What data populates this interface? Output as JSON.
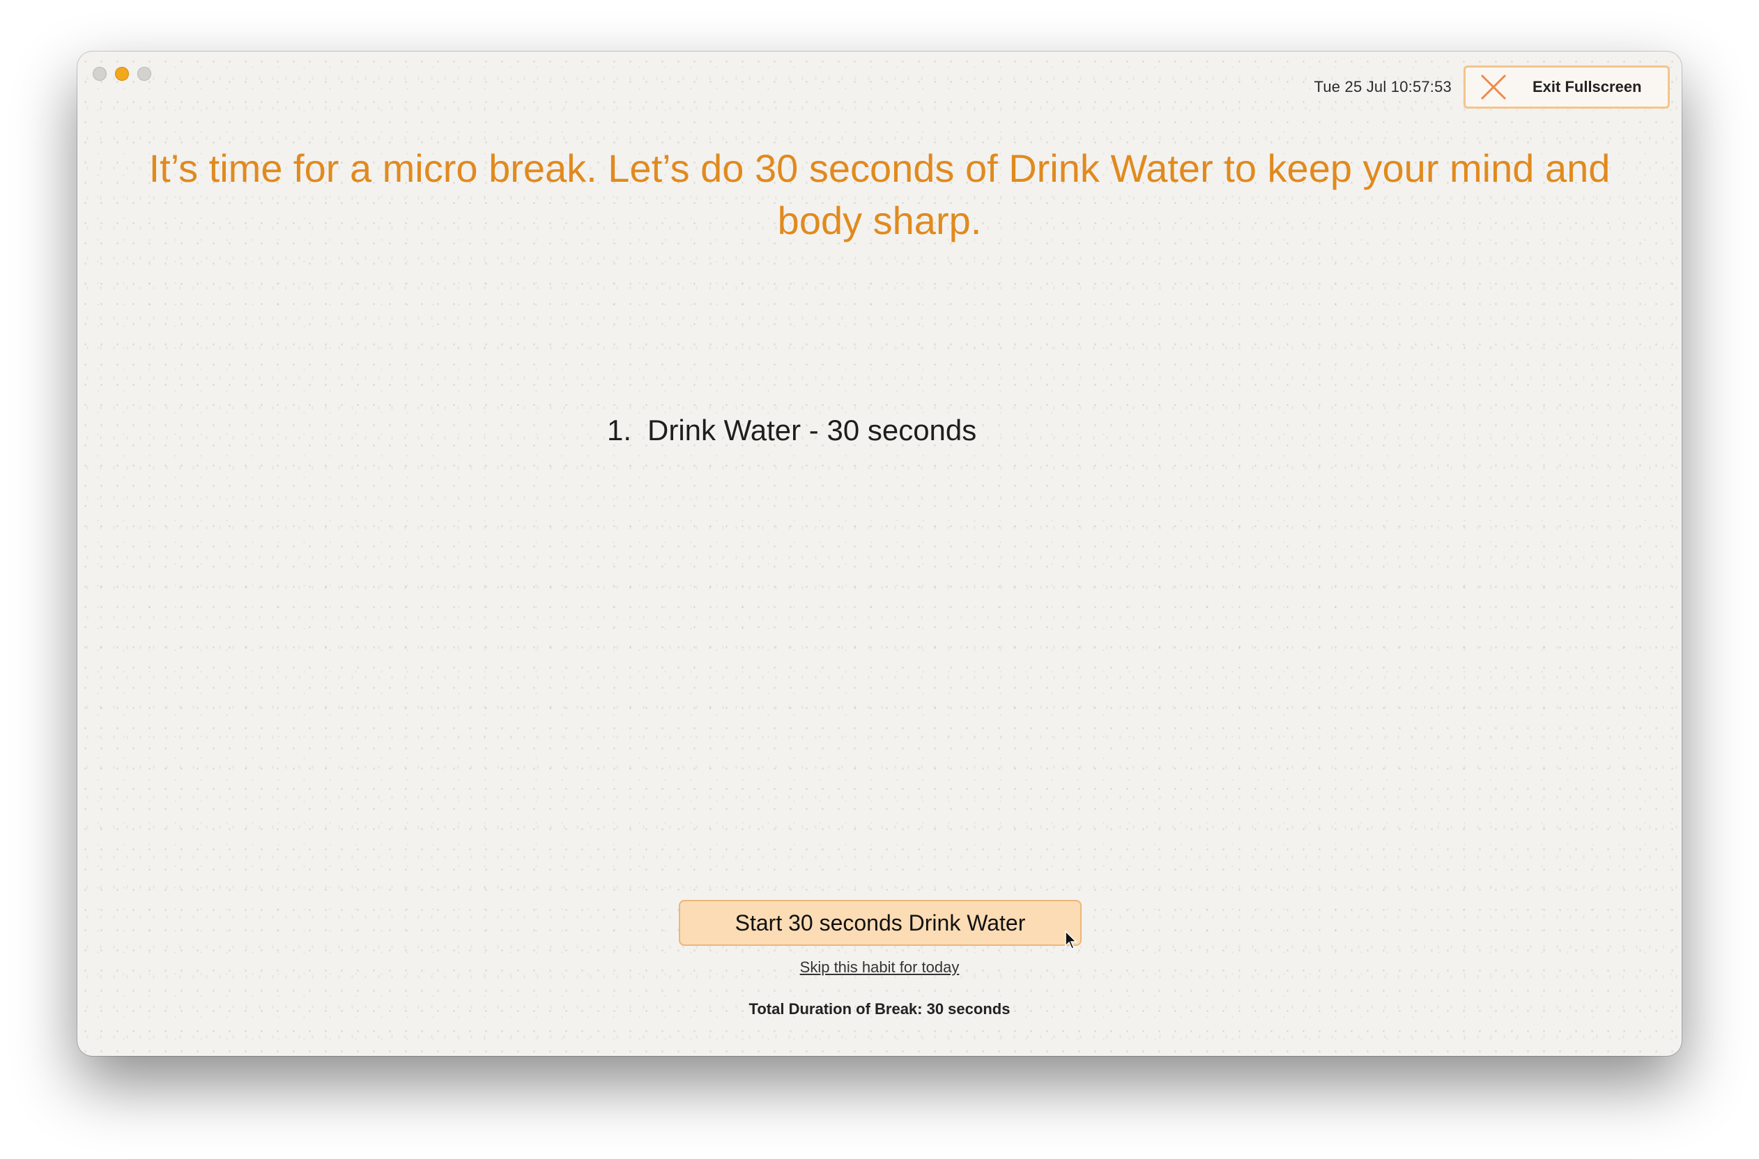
{
  "window": {
    "controls": [
      "close",
      "minimize",
      "zoom"
    ]
  },
  "header": {
    "clock": "Tue 25 Jul 10:57:53",
    "exit_button": {
      "label": "Exit Fullscreen",
      "icon": "close-x-icon"
    }
  },
  "main": {
    "headline": "It’s time for a micro break. Let’s do 30 seconds of Drink Water to keep your mind and body sharp.",
    "habits": [
      {
        "number": "1.",
        "label": "Drink Water - 30 seconds"
      }
    ],
    "start_button": "Start 30 seconds Drink Water",
    "skip_link": "Skip this habit for today",
    "total_duration": "Total Duration of Break: 30 seconds"
  },
  "colors": {
    "accent": "#e08a1e",
    "button_fill": "#fbdcb5",
    "button_border": "#eab77a",
    "background": "#f4f2ef"
  }
}
